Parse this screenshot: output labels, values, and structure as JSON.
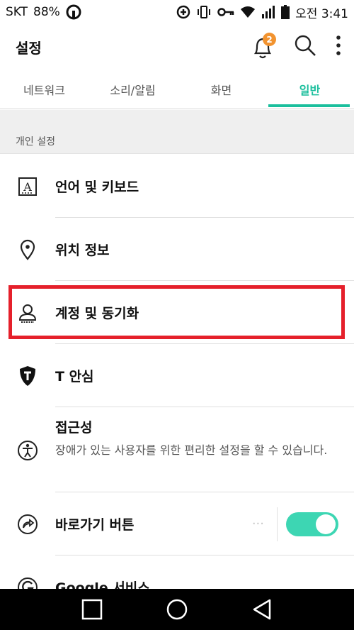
{
  "status": {
    "carrier": "SKT",
    "battery": "88%",
    "right_text": "오전 3:41"
  },
  "appbar": {
    "title": "설정",
    "notification_count": "2"
  },
  "tabs": [
    {
      "label": "네트워크",
      "active": false
    },
    {
      "label": "소리/알림",
      "active": false
    },
    {
      "label": "화면",
      "active": false
    },
    {
      "label": "일반",
      "active": true
    }
  ],
  "section": {
    "title": "개인 설정"
  },
  "items": [
    {
      "label": "언어 및 키보드",
      "icon": "language-icon"
    },
    {
      "label": "위치 정보",
      "icon": "location-pin-icon"
    },
    {
      "label": "계정 및 동기화",
      "icon": "account-icon",
      "highlighted": true
    },
    {
      "label": "T 안심",
      "icon": "shield-icon"
    },
    {
      "label": "접근성",
      "icon": "accessibility-icon",
      "description": "장애가 있는 사용자를 위한 편리한 설정을 할 수 있습니다."
    },
    {
      "label": "바로가기 버튼",
      "icon": "shortcut-icon",
      "toggle": true
    },
    {
      "label": "Google 서비스",
      "icon": "google-icon"
    }
  ],
  "colors": {
    "accent": "#1bbf9d",
    "badge": "#f2932f",
    "highlight": "#e5202b",
    "toggle_on": "#3dd6b3"
  }
}
